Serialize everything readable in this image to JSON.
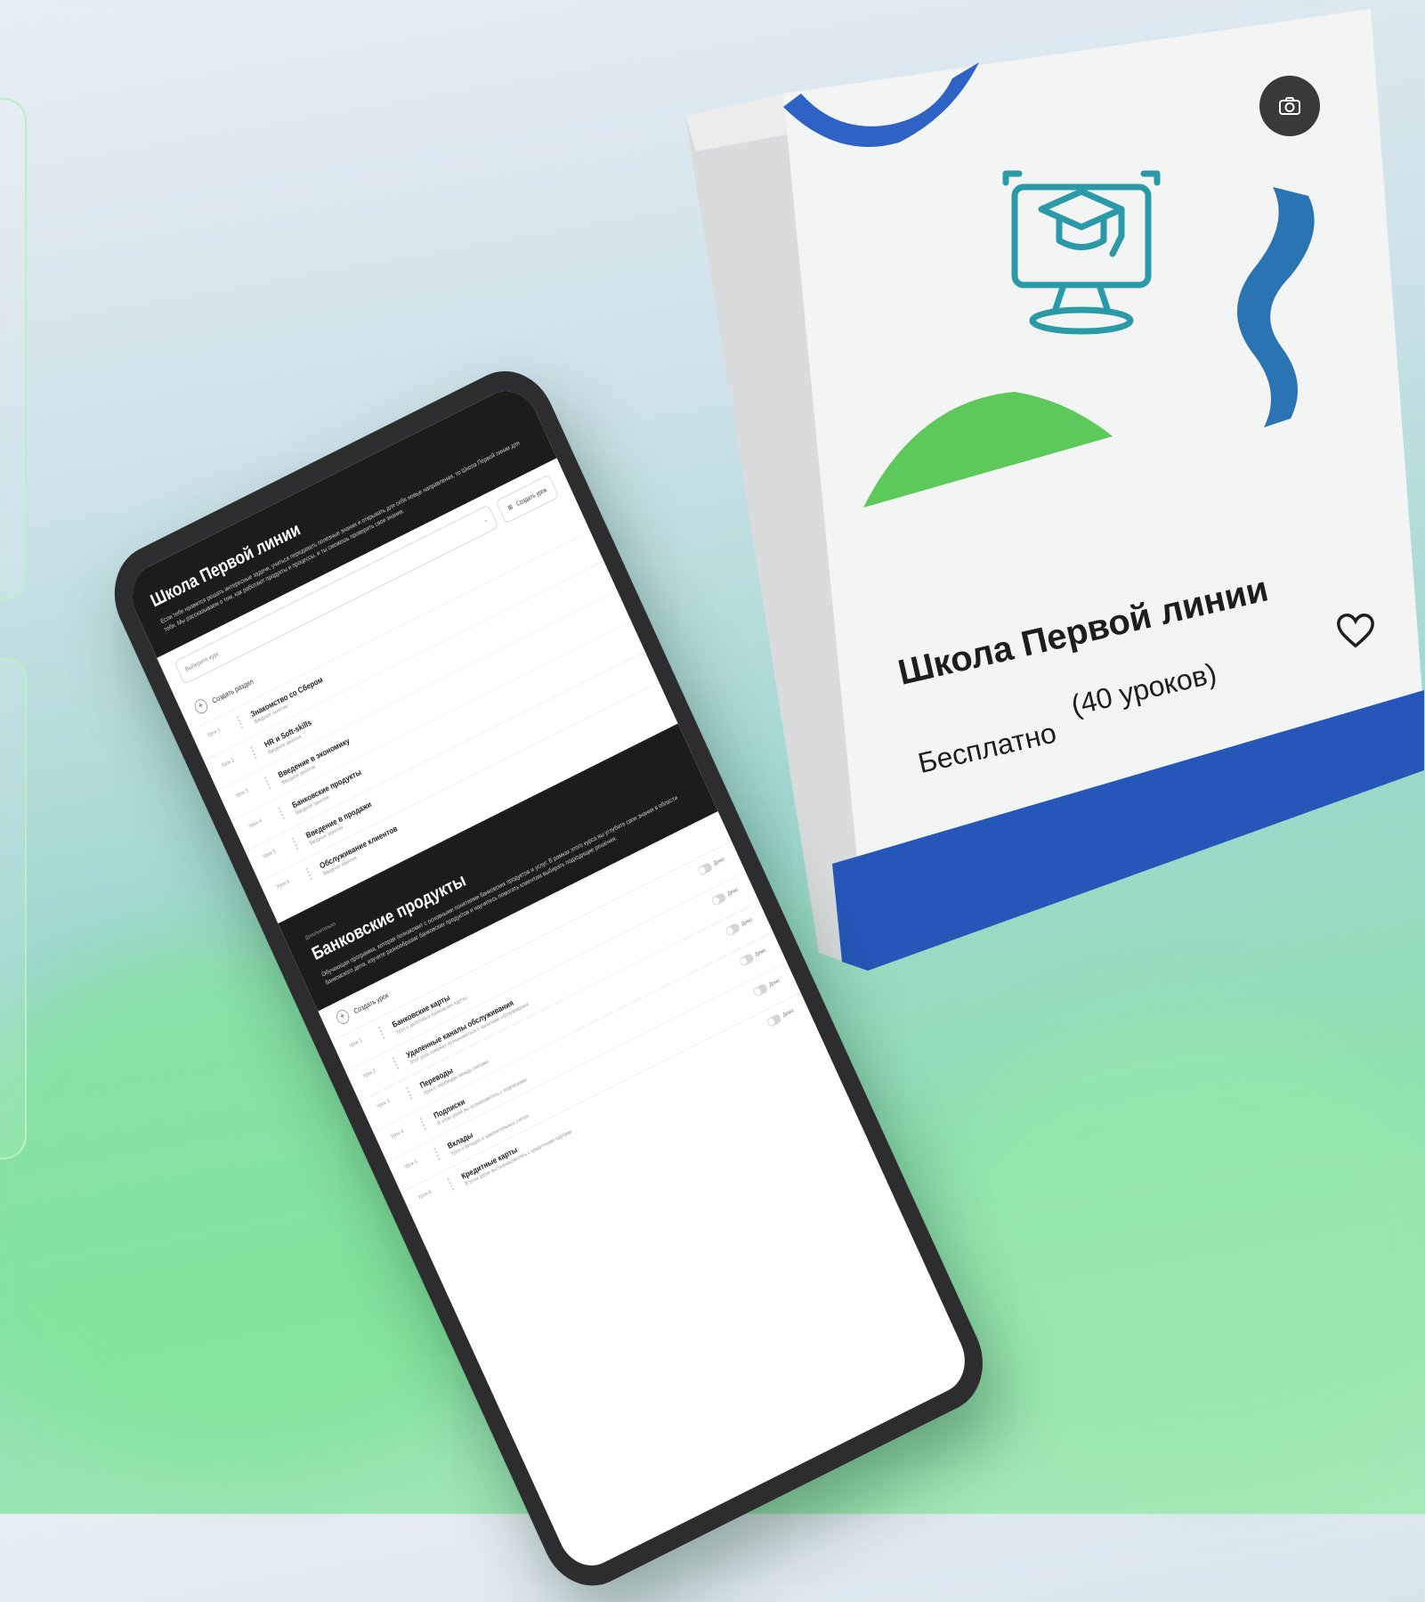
{
  "product": {
    "title": "Школа Первой линии",
    "price": "Бесплатно",
    "lessons": "(40 уроков)",
    "icons": [
      "camera-icon",
      "graduation-monitor-icon",
      "heart-icon"
    ],
    "colors": {
      "blue": "#2457b8",
      "green": "#5cc95a",
      "teal": "#2a9aa8"
    }
  },
  "tablet": {
    "section1": {
      "title": "Школа Первой линии",
      "description": "Если тебе нравится решать интересные задачи, учиться передавать полезные знания и открывать для себя новые направления, то Школа Первой линии для тебя. Мы рассказываем о том, как работают продукты и процессы, и ты сможешь проверить свои знания.",
      "select_placeholder": "Выберите курс",
      "create_button": "Создать урок",
      "add_label": "Создать раздел",
      "lessons": [
        {
          "num": "Урок 1",
          "title": "Знакомство со Сбером",
          "sub": "Вводное занятие"
        },
        {
          "num": "Урок 2",
          "title": "HR и Soft-skills",
          "sub": "Вводное занятие"
        },
        {
          "num": "Урок 3",
          "title": "Введение в экономику",
          "sub": "Вводное занятие"
        },
        {
          "num": "Урок 4",
          "title": "Банковские продукты",
          "sub": "Вводное занятие"
        },
        {
          "num": "Урок 5",
          "title": "Введение в продажи",
          "sub": "Вводное занятие"
        },
        {
          "num": "Урок 6",
          "title": "Обслуживание клиентов",
          "sub": "Вводное занятие"
        }
      ]
    },
    "section2": {
      "hint": "Дополнительно",
      "title": "Банковские продукты",
      "description": "Обучающая программа, которая познакомит с основными понятиями банковских продуктов и услуг. В рамках этого курса вы углубите свои знания в области банковского дела, изучите разнообразие банковских продуктов и научитесь помогать клиентам выбирать подходящие решения.",
      "add_label": "Создать урок",
      "toggle_label": "Демо",
      "lessons": [
        {
          "num": "Урок 1",
          "title": "Банковские карты",
          "sub": "Урок о дебетовых банковских картах"
        },
        {
          "num": "Урок 2",
          "title": "Удаленные каналы обслуживания",
          "sub": "Этот урок поможет познакомиться с каналами обслуживания"
        },
        {
          "num": "Урок 3",
          "title": "Переводы",
          "sub": "Урок о переводах между счетами"
        },
        {
          "num": "Урок 4",
          "title": "Подписки",
          "sub": "В этом уроке вы познакомитесь с подписками"
        },
        {
          "num": "Урок 5",
          "title": "Вклады",
          "sub": "Урок о вкладах и накопительных счетах"
        },
        {
          "num": "Урок 6",
          "title": "Кредитные карты",
          "sub": "В этом уроке вы познакомитесь с кредитными картами"
        }
      ]
    }
  }
}
